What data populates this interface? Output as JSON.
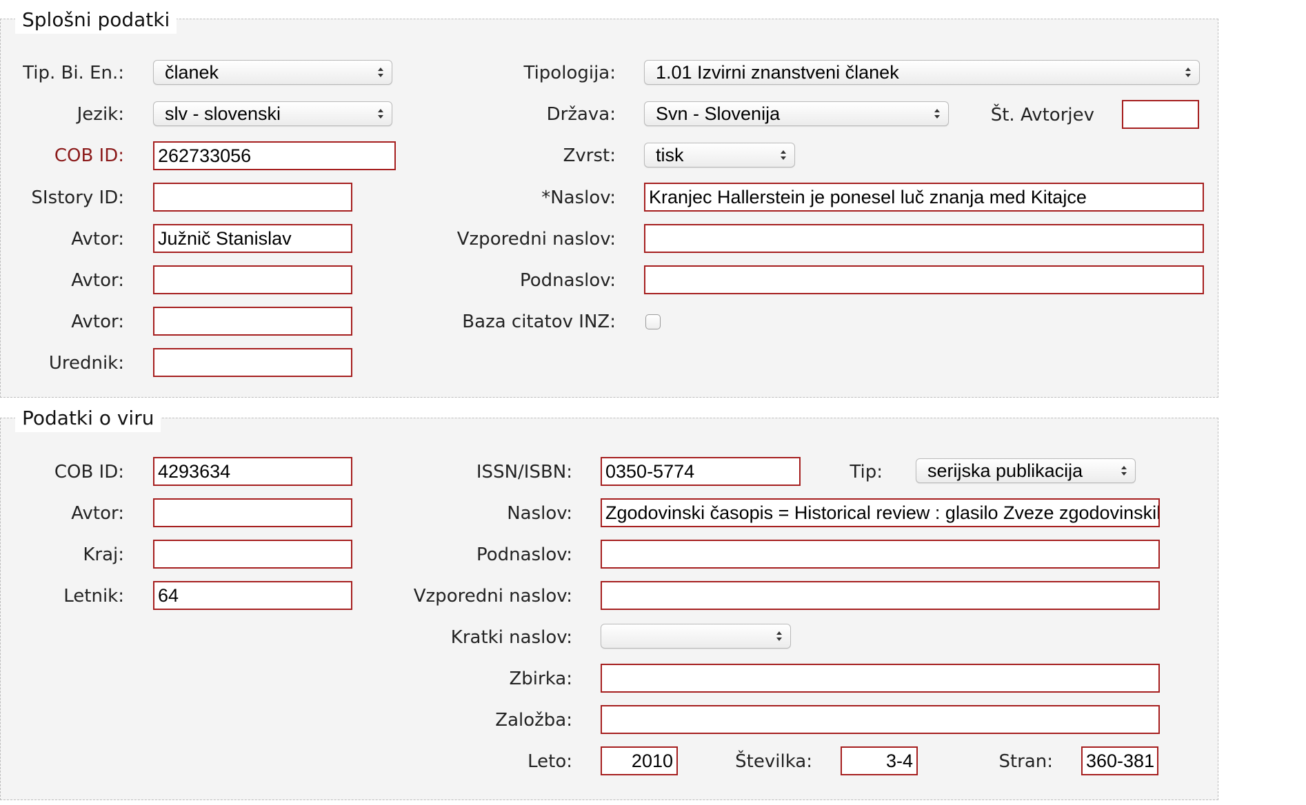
{
  "general": {
    "legend": "Splošni podatki",
    "tip_bi_en": {
      "label": "Tip. Bi. En.:",
      "value": "članek"
    },
    "jezik": {
      "label": "Jezik:",
      "value": "slv - slovenski"
    },
    "cob_id": {
      "label": "COB ID:",
      "value": "262733056"
    },
    "sistory_id": {
      "label": "SIstory ID:",
      "value": ""
    },
    "avtor_1": {
      "label": "Avtor:",
      "value": "Južnič Stanislav"
    },
    "avtor_2": {
      "label": "Avtor:",
      "value": ""
    },
    "avtor_3": {
      "label": "Avtor:",
      "value": ""
    },
    "urednik": {
      "label": "Urednik:",
      "value": ""
    },
    "tipologija": {
      "label": "Tipologija:",
      "value": "1.01 Izvirni znanstveni članek"
    },
    "drzava": {
      "label": "Država:",
      "value": "Svn - Slovenija"
    },
    "st_avtorjev": {
      "label": "Št. Avtorjev",
      "value": ""
    },
    "zvrst": {
      "label": "Zvrst:",
      "value": "tisk"
    },
    "naslov": {
      "label": "*Naslov:",
      "value": "Kranjec Hallerstein je ponesel luč znanja med Kitajce"
    },
    "vzporedni_naslov": {
      "label": "Vzporedni naslov:",
      "value": ""
    },
    "podnaslov": {
      "label": "Podnaslov:",
      "value": ""
    },
    "baza_citatov": {
      "label": "Baza citatov INZ:",
      "checked": false
    }
  },
  "source": {
    "legend": "Podatki o viru",
    "cob_id": {
      "label": "COB ID:",
      "value": "4293634"
    },
    "avtor": {
      "label": "Avtor:",
      "value": ""
    },
    "kraj": {
      "label": "Kraj:",
      "value": ""
    },
    "letnik": {
      "label": "Letnik:",
      "value": "64"
    },
    "issn_isbn": {
      "label": "ISSN/ISBN:",
      "value": "0350-5774"
    },
    "tip": {
      "label": "Tip:",
      "value": "serijska publikacija"
    },
    "naslov": {
      "label": "Naslov:",
      "value": "Zgodovinski časopis = Historical review : glasilo Zveze zgodovinskih"
    },
    "podnaslov": {
      "label": "Podnaslov:",
      "value": ""
    },
    "vzporedni_naslov": {
      "label": "Vzporedni naslov:",
      "value": ""
    },
    "kratki_naslov": {
      "label": "Kratki naslov:",
      "value": ""
    },
    "zbirka": {
      "label": "Zbirka:",
      "value": ""
    },
    "zalozba": {
      "label": "Založba:",
      "value": ""
    },
    "leto": {
      "label": "Leto:",
      "value": "2010"
    },
    "stevilka": {
      "label": "Številka:",
      "value": "3-4"
    },
    "stran": {
      "label": "Stran:",
      "value": "360-381"
    }
  },
  "colors": {
    "input_border": "#a51d1d",
    "required_label": "#8b1a1a",
    "panel_background": "#f4f4f4"
  },
  "icons": {
    "select_arrow": "up-down-chevron-icon"
  }
}
